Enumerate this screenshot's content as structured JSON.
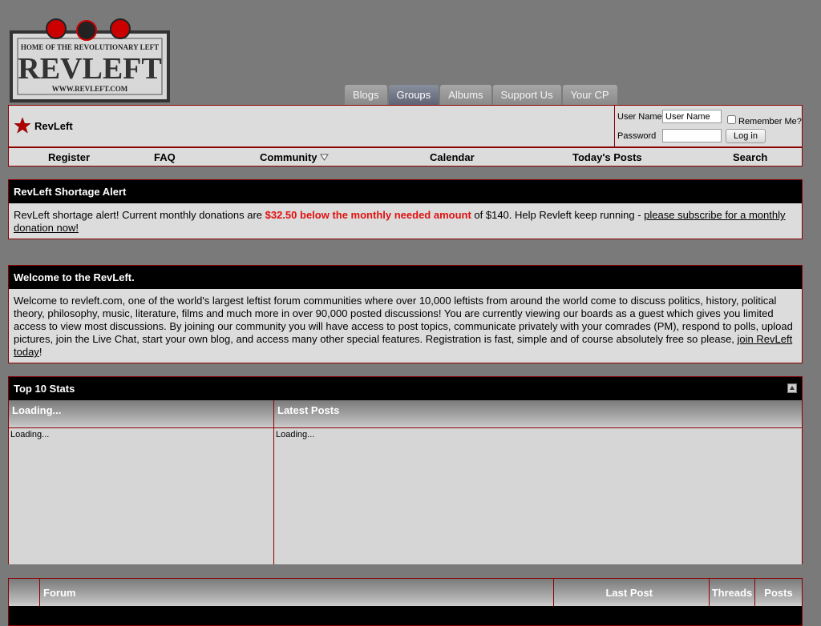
{
  "site": {
    "logo_tagline": "HOME OF THE REVOLUTIONARY LEFT",
    "logo_name": "REVLEFT",
    "logo_url": "WWW.REVLEFT.COM"
  },
  "tabs": [
    {
      "label": "Blogs"
    },
    {
      "label": "Groups"
    },
    {
      "label": "Albums"
    },
    {
      "label": "Support Us"
    },
    {
      "label": "Your CP"
    }
  ],
  "navbar": {
    "brand": "RevLeft"
  },
  "login": {
    "username_label": "User Name",
    "username_value": "User Name",
    "password_label": "Password",
    "remember_label": "Remember Me?",
    "button_label": "Log in"
  },
  "menu": [
    {
      "label": "Register"
    },
    {
      "label": "FAQ"
    },
    {
      "label": "Community"
    },
    {
      "label": "Calendar"
    },
    {
      "label": "Today's Posts"
    },
    {
      "label": "Search"
    }
  ],
  "alert": {
    "title": "RevLeft Shortage Alert",
    "text_before": "RevLeft shortage alert! Current monthly donations are ",
    "highlight": "$32.50 below the monthly needed amount",
    "text_after": " of $140. Help Revleft keep running - ",
    "link": "please subscribe for a monthly donation now!"
  },
  "welcome": {
    "title": "Welcome to the RevLeft.",
    "text": "Welcome to revleft.com, one of the world's largest leftist forum communities where over 10,000 leftists from around the world come to discuss politics, history, political theory, philosophy, music, literature, films and much more in over 90,000 posted discussions! You are currently viewing our boards as a guest which gives you limited access to view most discussions. By joining our community you will have access to post topics, communicate privately with your comrades (PM), respond to polls, upload pictures, join the Live Chat, start your own blog, and access many other special features. Registration is fast, simple and of course absolutely free so please, ",
    "link": "join RevLeft today",
    "end": "!"
  },
  "stats": {
    "title": "Top 10 Stats",
    "left_header": "Loading...",
    "left_body": "Loading...",
    "right_header": "Latest Posts",
    "right_body": "Loading..."
  },
  "forum_table": {
    "columns": [
      "Forum",
      "Last Post",
      "Threads",
      "Posts"
    ]
  },
  "colors": {
    "border": "#8b0000",
    "alert_red": "#e01010",
    "panel": "#dcdcdc",
    "background": "#7a7a7a"
  }
}
